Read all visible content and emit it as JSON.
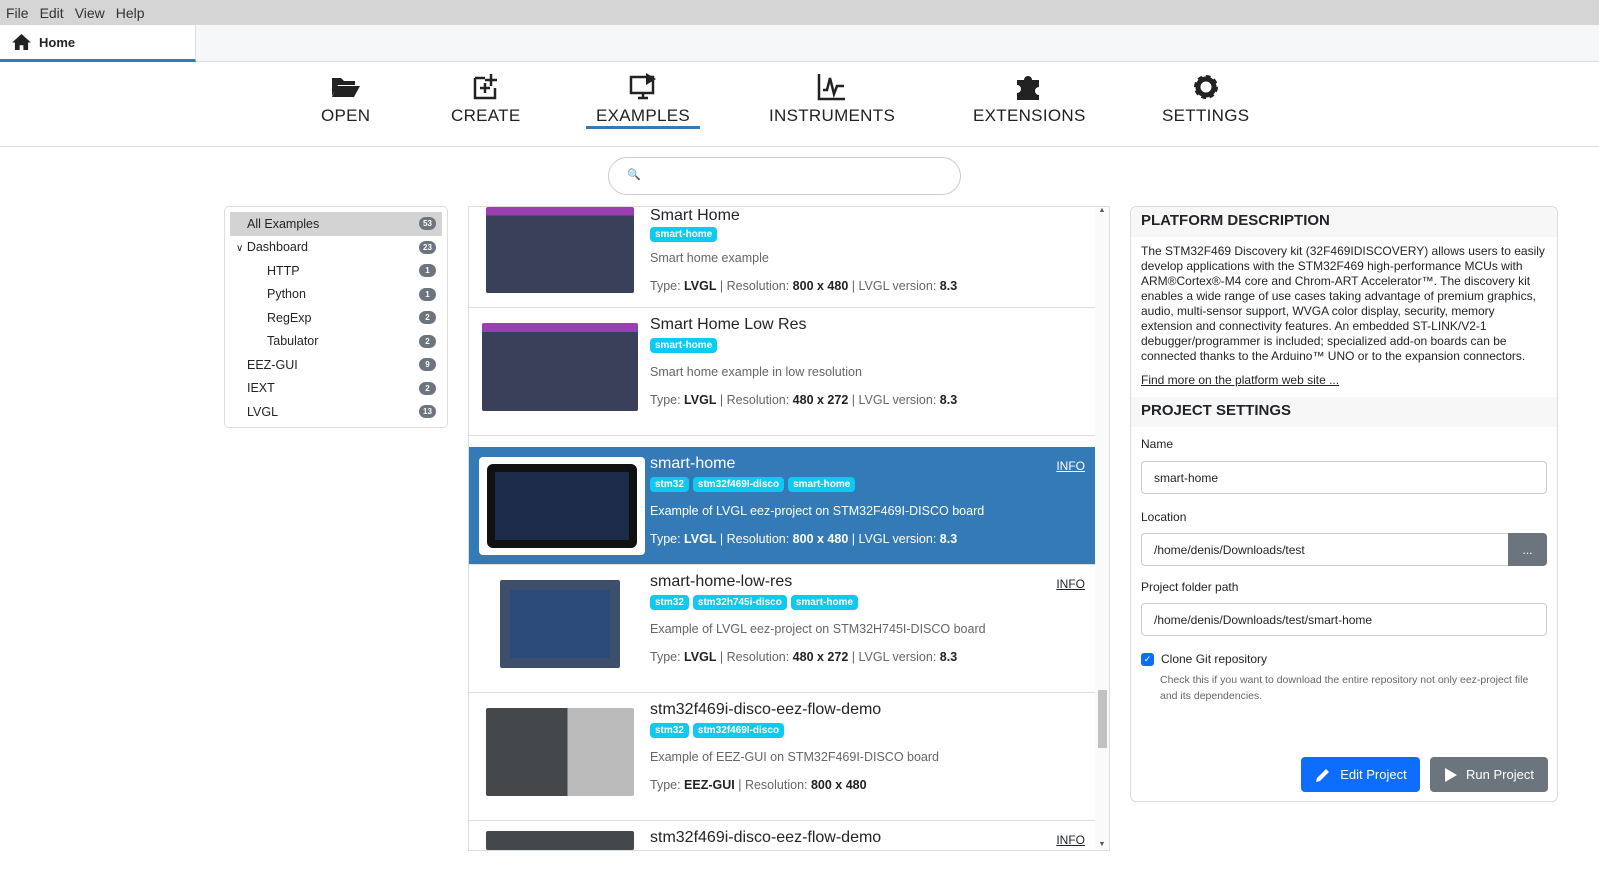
{
  "menu": [
    "File",
    "Edit",
    "View",
    "Help"
  ],
  "tab": {
    "label": "Home"
  },
  "nav": [
    {
      "label": "OPEN",
      "icon": "folder-open-icon"
    },
    {
      "label": "CREATE",
      "icon": "create-icon"
    },
    {
      "label": "EXAMPLES",
      "icon": "examples-icon",
      "active": true
    },
    {
      "label": "INSTRUMENTS",
      "icon": "chart-icon"
    },
    {
      "label": "EXTENSIONS",
      "icon": "puzzle-icon"
    },
    {
      "label": "SETTINGS",
      "icon": "gear-icon"
    }
  ],
  "search": {
    "placeholder": ""
  },
  "sidebar": [
    {
      "label": "All Examples",
      "count": "53"
    },
    {
      "label": "Dashboard",
      "count": "23"
    },
    {
      "label": "HTTP",
      "count": "1"
    },
    {
      "label": "Python",
      "count": "1"
    },
    {
      "label": "RegExp",
      "count": "2"
    },
    {
      "label": "Tabulator",
      "count": "2"
    },
    {
      "label": "EEZ-GUI",
      "count": "9"
    },
    {
      "label": "IEXT",
      "count": "2"
    },
    {
      "label": "LVGL",
      "count": "13"
    }
  ],
  "examples": [
    {
      "title": "Smart Home",
      "tags": [
        "smart-home"
      ],
      "desc": "Smart home example",
      "type": "LVGL",
      "res": "800 x 480",
      "ver": "8.3"
    },
    {
      "title": "Smart Home Low Res",
      "tags": [
        "smart-home"
      ],
      "desc": "Smart home example in low resolution",
      "type": "LVGL",
      "res": "480 x 272",
      "ver": "8.3"
    },
    {
      "title": "smart-home",
      "tags": [
        "stm32",
        "stm32f469I-disco",
        "smart-home"
      ],
      "desc": "Example of LVGL eez-project on STM32F469I-DISCO board",
      "type": "LVGL",
      "res": "800 x 480",
      "ver": "8.3",
      "info": "INFO"
    },
    {
      "title": "smart-home-low-res",
      "tags": [
        "stm32",
        "stm32h745i-disco",
        "smart-home"
      ],
      "desc": "Example of LVGL eez-project on STM32H745I-DISCO board",
      "type": "LVGL",
      "res": "480 x 272",
      "ver": "8.3",
      "info": "INFO"
    },
    {
      "title": "stm32f469i-disco-eez-flow-demo",
      "tags": [
        "stm32",
        "stm32f469I-disco"
      ],
      "desc": "Example of EEZ-GUI on STM32F469I-DISCO board",
      "type": "EEZ-GUI",
      "res": "800 x 480"
    },
    {
      "title": "stm32f469i-disco-eez-flow-demo",
      "info": "INFO"
    }
  ],
  "labels": {
    "type": "Type: ",
    "res": "Resolution: ",
    "ver": "LVGL version: "
  },
  "platform": {
    "heading": "PLATFORM DESCRIPTION",
    "text": "The STM32F469 Discovery kit (32F469IDISCOVERY) allows users to easily develop applications with the STM32F469 high-performance MCUs with ARM®Cortex®-M4 core and Chrom-ART Accelerator™. The discovery kit enables a wide range of use cases taking advantage of premium graphics, audio, multi-sensor support, WVGA color display, security, memory extension and connectivity features. An embedded ST-LINK/V2-1 debugger/programmer is included; specialized add-on boards can be connected thanks to the Arduino™ UNO or to the expansion connectors.",
    "link": "Find more on the platform web site ..."
  },
  "settings": {
    "heading": "PROJECT SETTINGS",
    "name_label": "Name",
    "name": "smart-home",
    "location_label": "Location",
    "location": "/home/denis/Downloads/test",
    "browse": "...",
    "folder_label": "Project folder path",
    "folder": "/home/denis/Downloads/test/smart-home",
    "clone_label": "Clone Git repository",
    "clone_checked": true,
    "clone_help": "Check this if you want to download the entire repository not only eez-project file and its dependencies.",
    "edit": "Edit Project",
    "run": "Run Project"
  },
  "colors": {
    "accent": "#337ab7",
    "tag": "#0dcaf0",
    "primary": "#0d6efd",
    "secondary": "#6c757d"
  }
}
